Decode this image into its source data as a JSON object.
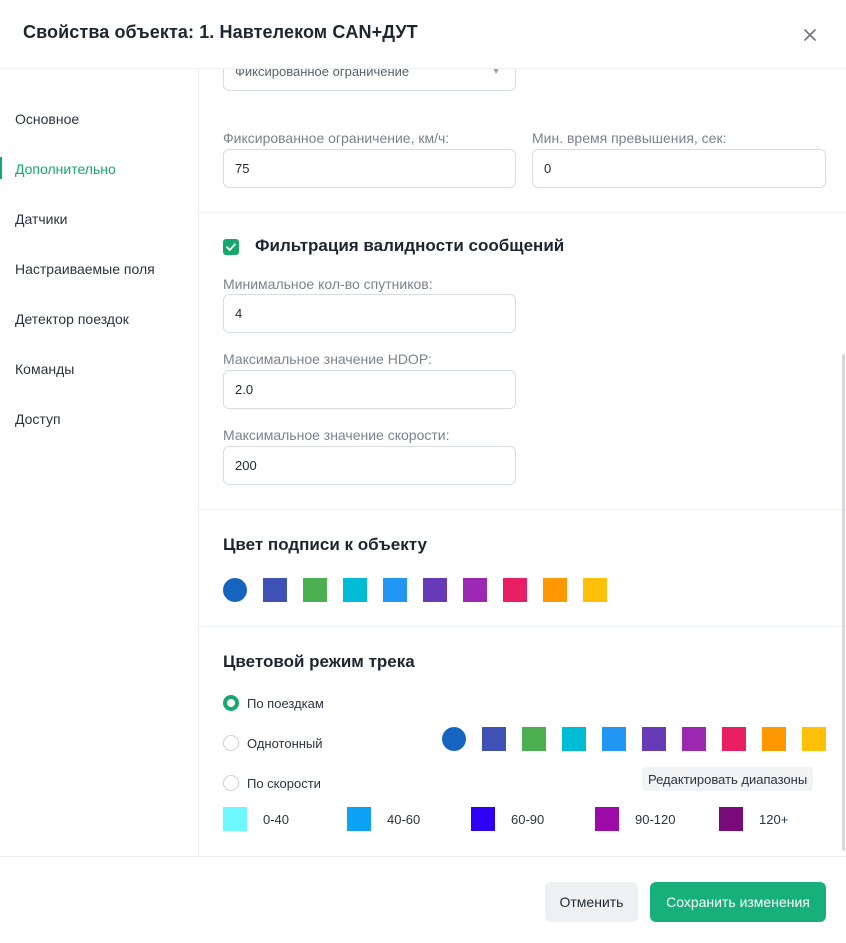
{
  "dialog": {
    "title": "Свойства объекта: 1. Навтелеком CAN+ДУТ"
  },
  "sidebar": {
    "items": [
      {
        "label": "Основное",
        "active": false
      },
      {
        "label": "Дополнительно",
        "active": true
      },
      {
        "label": "Датчики",
        "active": false
      },
      {
        "label": "Настраиваемые поля",
        "active": false
      },
      {
        "label": "Детектор поездок",
        "active": false
      },
      {
        "label": "Команды",
        "active": false
      },
      {
        "label": "Доступ",
        "active": false
      }
    ]
  },
  "speed": {
    "limit_type_value": "Фиксированное ограничение",
    "fixed_limit_label": "Фиксированное ограничение, км/ч:",
    "fixed_limit_value": "75",
    "min_exceed_label": "Мин. время превышения, сек:",
    "min_exceed_value": "0"
  },
  "validity_filter": {
    "checked": true,
    "title": "Фильтрация валидности сообщений",
    "min_satellites_label": "Минимальное кол-во спутников:",
    "min_satellites_value": "4",
    "max_hdop_label": "Максимальное значение HDOP:",
    "max_hdop_value": "2.0",
    "max_speed_label": "Максимальное значение скорости:",
    "max_speed_value": "200"
  },
  "label_color": {
    "title": "Цвет подписи к объекту",
    "selected_index": 0,
    "colors": [
      "#1565c0",
      "#3f51b5",
      "#4caf50",
      "#00bcd4",
      "#2196f3",
      "#673ab7",
      "#9c27b0",
      "#e91e63",
      "#ff9800",
      "#ffc107"
    ]
  },
  "track_color": {
    "title": "Цветовой режим трека",
    "modes": [
      {
        "label": "По поездкам",
        "checked": true
      },
      {
        "label": "Однотонный",
        "checked": false
      },
      {
        "label": "По скорости",
        "checked": false
      }
    ],
    "solid_selected_index": 0,
    "solid_colors": [
      "#1565c0",
      "#3f51b5",
      "#4caf50",
      "#00bcd4",
      "#2196f3",
      "#673ab7",
      "#9c27b0",
      "#e91e63",
      "#ff9800",
      "#ffc107"
    ],
    "edit_ranges_label": "Редактировать диапазоны",
    "speed_ranges": [
      {
        "label": "0-40",
        "color": "#6ff7ff"
      },
      {
        "label": "40-60",
        "color": "#0ea2f5"
      },
      {
        "label": "60-90",
        "color": "#2d00f5"
      },
      {
        "label": "90-120",
        "color": "#9c0aa8"
      },
      {
        "label": "120+",
        "color": "#780a7a"
      }
    ]
  },
  "footer": {
    "cancel_label": "Отменить",
    "save_label": "Сохранить изменения"
  }
}
